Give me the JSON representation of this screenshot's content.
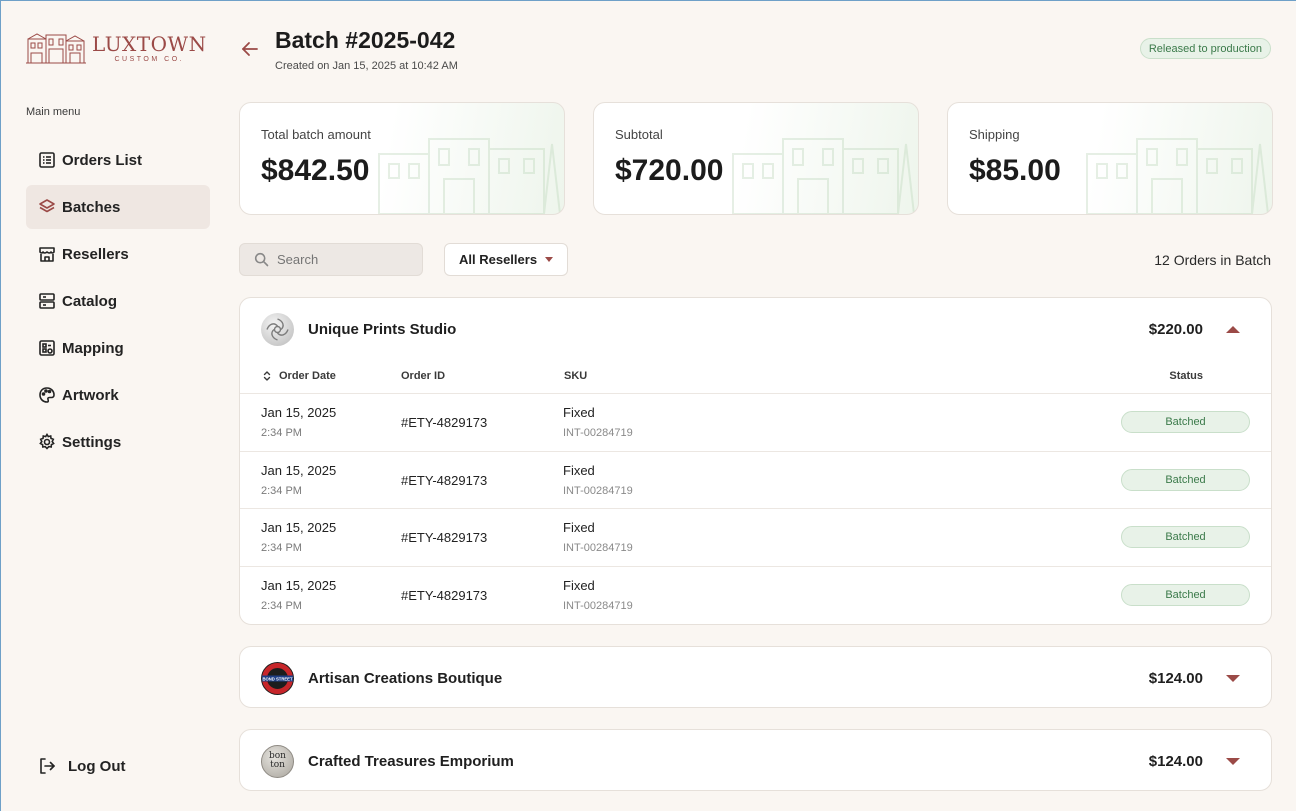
{
  "brand": {
    "name": "LUXTOWN",
    "tagline": "CUSTOM CO."
  },
  "sidebar": {
    "menu_label": "Main menu",
    "items": [
      {
        "label": "Orders List",
        "icon": "list-icon",
        "active": false
      },
      {
        "label": "Batches",
        "icon": "layers-icon",
        "active": true
      },
      {
        "label": "Resellers",
        "icon": "store-icon",
        "active": false
      },
      {
        "label": "Catalog",
        "icon": "catalog-icon",
        "active": false
      },
      {
        "label": "Mapping",
        "icon": "mapping-icon",
        "active": false
      },
      {
        "label": "Artwork",
        "icon": "palette-icon",
        "active": false
      },
      {
        "label": "Settings",
        "icon": "gear-icon",
        "active": false
      }
    ],
    "logout_label": "Log Out"
  },
  "header": {
    "title": "Batch #2025-042",
    "subtitle": "Created on Jan 15, 2025 at 10:42 AM",
    "status": "Released to production"
  },
  "summary": {
    "total": {
      "label": "Total batch amount",
      "value": "$842.50"
    },
    "subtotal": {
      "label": "Subtotal",
      "value": "$720.00"
    },
    "shipping": {
      "label": "Shipping",
      "value": "$85.00"
    }
  },
  "toolbar": {
    "search_placeholder": "Search",
    "filter_label": "All Resellers",
    "order_count": "12 Orders in Batch"
  },
  "table_headers": {
    "date": "Order Date",
    "id": "Order ID",
    "sku": "SKU",
    "status": "Status"
  },
  "groups": [
    {
      "name": "Unique Prints Studio",
      "amount": "$220.00",
      "expanded": true,
      "rows": [
        {
          "date": "Jan 15, 2025",
          "time": "2:34 PM",
          "id": "#ETY-4829173",
          "sku": "Fixed",
          "sku_code": "INT-00284719",
          "status": "Batched"
        },
        {
          "date": "Jan 15, 2025",
          "time": "2:34 PM",
          "id": "#ETY-4829173",
          "sku": "Fixed",
          "sku_code": "INT-00284719",
          "status": "Batched"
        },
        {
          "date": "Jan 15, 2025",
          "time": "2:34 PM",
          "id": "#ETY-4829173",
          "sku": "Fixed",
          "sku_code": "INT-00284719",
          "status": "Batched"
        },
        {
          "date": "Jan 15, 2025",
          "time": "2:34 PM",
          "id": "#ETY-4829173",
          "sku": "Fixed",
          "sku_code": "INT-00284719",
          "status": "Batched"
        }
      ]
    },
    {
      "name": "Artisan Creations Boutique",
      "amount": "$124.00",
      "expanded": false,
      "avatar_text": "BOND STREET"
    },
    {
      "name": "Crafted Treasures Emporium",
      "amount": "$124.00",
      "expanded": false,
      "avatar_text": "bon ton"
    }
  ],
  "colors": {
    "accent": "#9b4a47",
    "status_green": "#3b7a4a",
    "status_bg": "#e8f2e8",
    "page_bg": "#faf6f2"
  }
}
